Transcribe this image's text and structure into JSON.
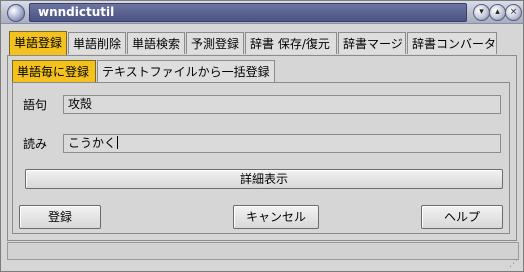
{
  "window": {
    "title": "wnndictutil"
  },
  "title_buttons": {
    "minimize": "▾",
    "maximize": "▴",
    "close": "×"
  },
  "tabs": [
    {
      "label": "単語登録",
      "active": true
    },
    {
      "label": "単語削除",
      "active": false
    },
    {
      "label": "単語検索",
      "active": false
    },
    {
      "label": "予測登録",
      "active": false
    },
    {
      "label": "辞書 保存/復元",
      "active": false
    },
    {
      "label": "辞書マージ",
      "active": false
    },
    {
      "label": "辞書コンバータ",
      "active": false
    }
  ],
  "subtabs": [
    {
      "label": "単語毎に登録",
      "active": true
    },
    {
      "label": "テキストファイルから一括登録",
      "active": false
    }
  ],
  "form": {
    "word_label": "語句",
    "word_value": "攻殻",
    "reading_label": "読み",
    "reading_value": "こうかく",
    "details_button": "詳細表示"
  },
  "actions": {
    "register": "登録",
    "cancel": "キャンセル",
    "help": "ヘルプ"
  },
  "colors": {
    "active_tab": "#f4c21f",
    "background": "#d6d6d6"
  }
}
